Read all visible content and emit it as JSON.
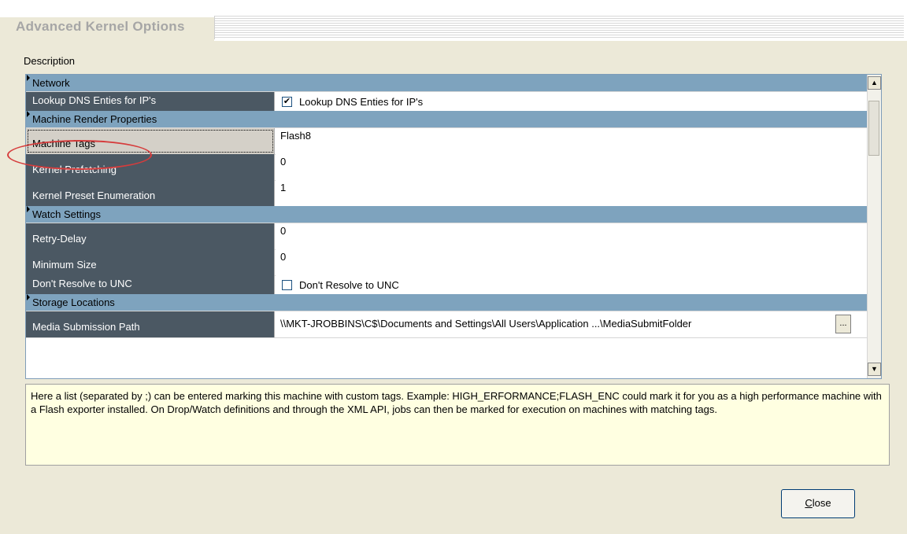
{
  "title": "Advanced Kernel Options",
  "description_label": "Description",
  "properties": [
    {
      "kind": "category",
      "label": "Network"
    },
    {
      "kind": "checkbox",
      "name": "Lookup DNS Enties for IP's",
      "checked": true,
      "value_label": "Lookup DNS Enties for IP's"
    },
    {
      "kind": "category",
      "label": "Machine Render Properties"
    },
    {
      "kind": "text",
      "name": "Machine Tags",
      "value": "Flash8",
      "selected": true
    },
    {
      "kind": "text",
      "name": "Kernel Prefetching",
      "value": "0"
    },
    {
      "kind": "text",
      "name": "Kernel Preset Enumeration",
      "value": "1"
    },
    {
      "kind": "category",
      "label": "Watch Settings"
    },
    {
      "kind": "text",
      "name": "Retry-Delay",
      "value": "0"
    },
    {
      "kind": "text",
      "name": "Minimum Size",
      "value": "0"
    },
    {
      "kind": "checkbox",
      "name": "Don't Resolve to UNC",
      "checked": false,
      "value_label": "Don't Resolve to UNC"
    },
    {
      "kind": "category",
      "label": "Storage Locations"
    },
    {
      "kind": "path",
      "name": "Media Submission Path",
      "value": "\\\\MKT-JROBBINS\\C$\\Documents and Settings\\All Users\\Application ...\\MediaSubmitFolder"
    }
  ],
  "ellipsis_button": "...",
  "help_text": "Here a list (separated by ;) can be entered marking this machine with custom tags. Example: HIGH_ERFORMANCE;FLASH_ENC could mark it for you as a high performance machine with a Flash exporter installed. On Drop/Watch definitions and through the XML API, jobs can then be marked for execution on machines with matching tags.",
  "close_button": {
    "mnemonic": "C",
    "rest": "lose"
  },
  "colors": {
    "category": "#7ea3be",
    "name_cell": "#4b5863",
    "help_bg": "#ffffe1",
    "highlight": "#d63c3c"
  }
}
